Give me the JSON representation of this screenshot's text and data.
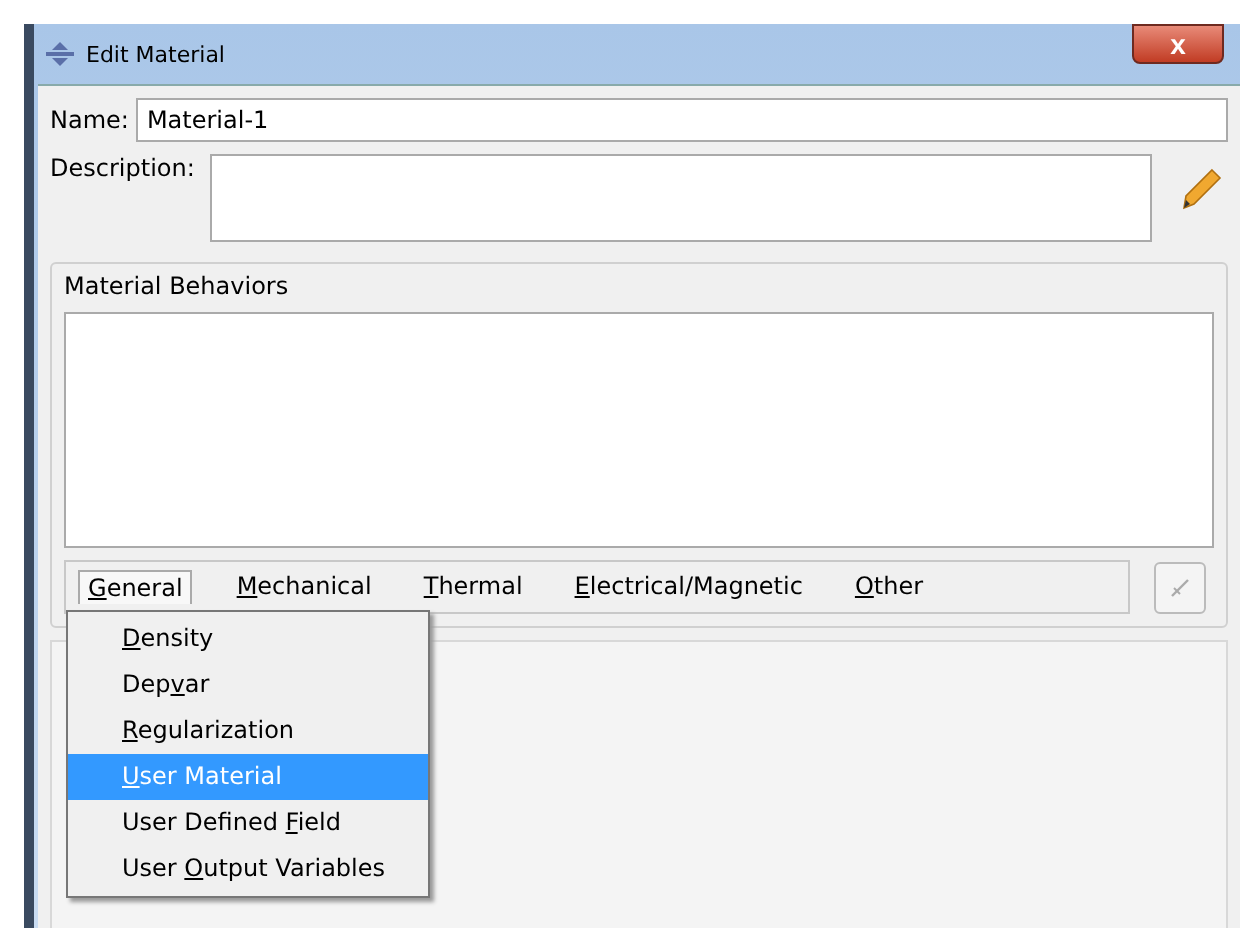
{
  "window": {
    "title": "Edit Material",
    "close": "x"
  },
  "name": {
    "label": "Name:",
    "value": "Material-1"
  },
  "description": {
    "label": "Description:"
  },
  "behaviors": {
    "title": "Material Behaviors"
  },
  "menus": [
    {
      "key": "G",
      "post": "eneral",
      "selected": true
    },
    {
      "key": "M",
      "post": "echanical",
      "selected": false
    },
    {
      "key": "T",
      "post": "hermal",
      "selected": false
    },
    {
      "key": "E",
      "post": "lectrical/Magnetic",
      "selected": false
    },
    {
      "key": "O",
      "post": "ther",
      "selected": false
    }
  ],
  "dropdown": [
    {
      "key": "D",
      "post": "ensity",
      "selected": false
    },
    {
      "pre": "Dep",
      "key": "v",
      "post": "ar",
      "selected": false
    },
    {
      "key": "R",
      "post": "egularization",
      "selected": false
    },
    {
      "key": "U",
      "post": "ser Material",
      "selected": true
    },
    {
      "pre": "User Defined ",
      "key": "F",
      "post": "ield",
      "selected": false
    },
    {
      "pre": "User ",
      "key": "O",
      "post": "utput Variables",
      "selected": false
    }
  ]
}
